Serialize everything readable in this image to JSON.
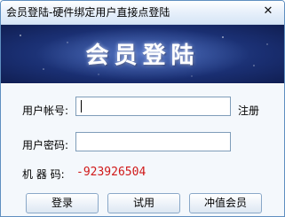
{
  "window": {
    "title": "会员登陆-硬件绑定用户直接点登陆",
    "close_glyph": "✕"
  },
  "banner": {
    "heading": "会员登陆"
  },
  "form": {
    "account_label": "用户帐号:",
    "account_value": "",
    "register_link": "注册",
    "password_label": "用户密码:",
    "password_value": "",
    "machine_label": "机 器 码:",
    "machine_code": "-923926504"
  },
  "buttons": {
    "login": "登录",
    "trial": "试用",
    "recharge": "冲值会员"
  },
  "colors": {
    "banner": "#1a2f72",
    "machine_code": "#d01818"
  }
}
